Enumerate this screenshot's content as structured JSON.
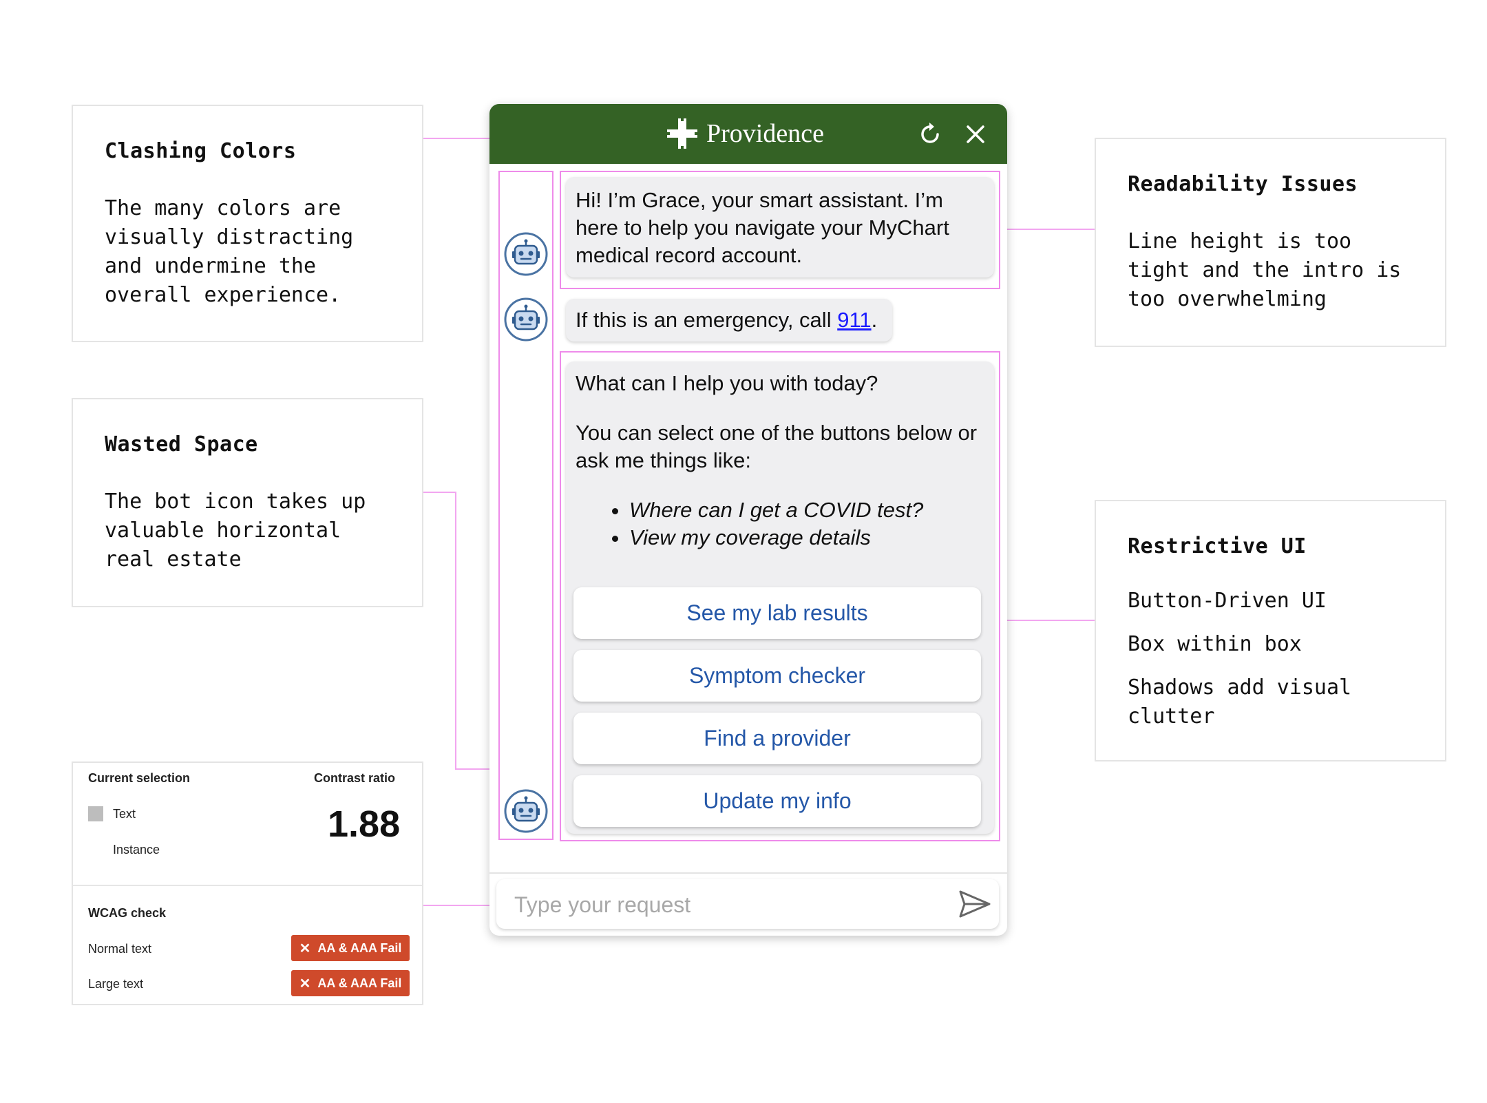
{
  "annotations": {
    "clashing": {
      "title": "Clashing Colors",
      "body": "The many colors are\nvisually distracting\nand undermine the\noverall experience."
    },
    "wasted": {
      "title": "Wasted Space",
      "body": "The bot icon takes up\nvaluable horizontal\nreal estate"
    },
    "readability": {
      "title": "Readability Issues",
      "body": "Line height is too\ntight and the intro is\ntoo overwhelming"
    },
    "restrictive": {
      "title": "Restrictive UI",
      "point1": "Button-Driven UI",
      "point2": "Box within box",
      "point3": "Shadows add visual\nclutter"
    }
  },
  "chat": {
    "brand": "Providence",
    "header_color": "#346225",
    "messages": {
      "intro": "Hi! I’m Grace, your smart assistant. I’m here to help you navigate your MyChart medical record account.",
      "emergency_prefix": "If this is an emergency, call ",
      "emergency_link": "911",
      "emergency_suffix": ".",
      "help_question": "What can I help you with today?",
      "help_text": "You can select one of the buttons below or ask me things like:",
      "examples": [
        "Where can I get a COVID test?",
        "View my coverage details"
      ]
    },
    "buttons": [
      "See my lab results",
      "Symptom checker",
      "Find a provider",
      "Update my info"
    ],
    "input_placeholder": "Type your request",
    "icons": {
      "refresh": "refresh-icon",
      "close": "close-icon",
      "send": "send-icon",
      "bot": "bot-avatar-icon",
      "logo": "providence-cross-icon"
    }
  },
  "contrast_panel": {
    "current_selection_label": "Current selection",
    "contrast_ratio_label": "Contrast ratio",
    "text_label": "Text",
    "instance_label": "Instance",
    "ratio": "1.88",
    "wcag_label": "WCAG check",
    "normal_text_label": "Normal text",
    "large_text_label": "Large text",
    "normal_result": "AA & AAA Fail",
    "large_result": "AA & AAA Fail",
    "fail_color": "#cf4a2b"
  },
  "connector_color": "#f2a6f0"
}
